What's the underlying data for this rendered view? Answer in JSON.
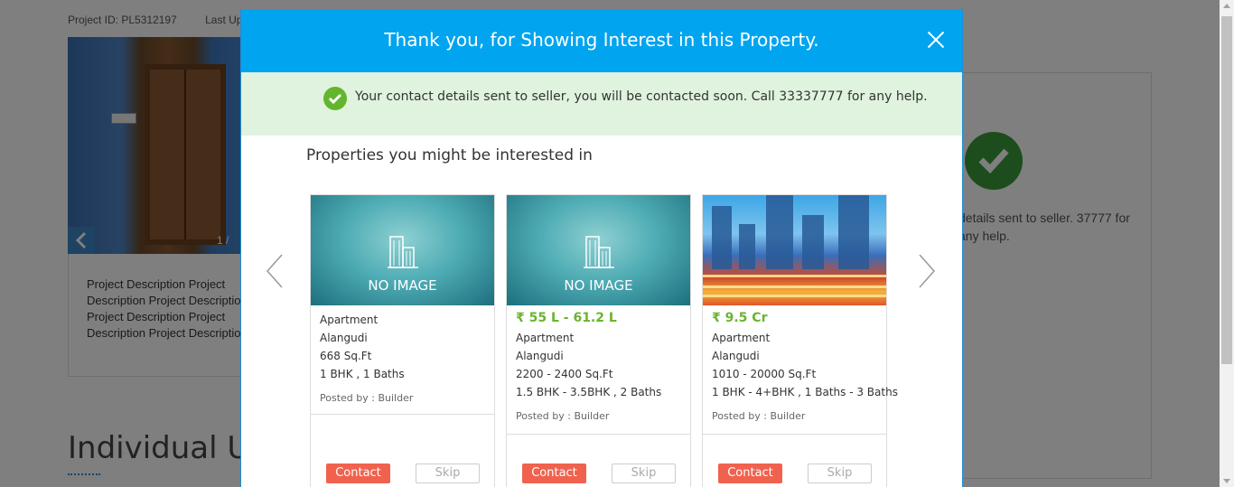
{
  "background": {
    "project_id": "Project ID: PL5312197",
    "last_updated": "Last Up",
    "gallery_counter": "1 /",
    "gallery_prev_icon": "chevron-left-icon",
    "description": "Project Description Project Description Project Description Project Description Project Description Project Description",
    "section_heading": "Individual U",
    "right_panel_text": "details sent to seller. 37777 for any help."
  },
  "modal": {
    "title": "Thank you, for Showing Interest in this Property.",
    "close_icon": "close-icon",
    "success_message": "Your contact details sent to seller, you will be contacted soon. Call 33337777 for any help.",
    "success_icon": "check-circle-icon",
    "suggestions_title": "Properties you might be interested in",
    "prev_icon": "chevron-left-icon",
    "next_icon": "chevron-right-icon"
  },
  "cards": [
    {
      "image_label": "NO IMAGE",
      "price": "",
      "type": "Apartment",
      "location": "Alangudi",
      "area": "668 Sq.Ft",
      "config": "1 BHK , 1 Baths",
      "posted_by": "Posted by : Builder",
      "contact_label": "Contact",
      "skip_label": "Skip"
    },
    {
      "image_label": "NO IMAGE",
      "price": "₹ 55 L - 61.2 L",
      "type": "Apartment",
      "location": "Alangudi",
      "area": "2200 - 2400 Sq.Ft",
      "config": "1.5 BHK - 3.5BHK , 2 Baths",
      "posted_by": "Posted by : Builder",
      "contact_label": "Contact",
      "skip_label": "Skip"
    },
    {
      "image_label": "",
      "price": "₹ 9.5 Cr",
      "type": "Apartment",
      "location": "Alangudi",
      "area": "1010 - 20000 Sq.Ft",
      "config": "1 BHK - 4+BHK , 1 Baths - 3 Baths",
      "posted_by": "Posted by : Builder",
      "contact_label": "Contact",
      "skip_label": "Skip"
    }
  ],
  "colors": {
    "header": "#00a4ef",
    "success_bg": "#dff3de",
    "price": "#6ab42e",
    "contact_button": "#f0624e"
  }
}
